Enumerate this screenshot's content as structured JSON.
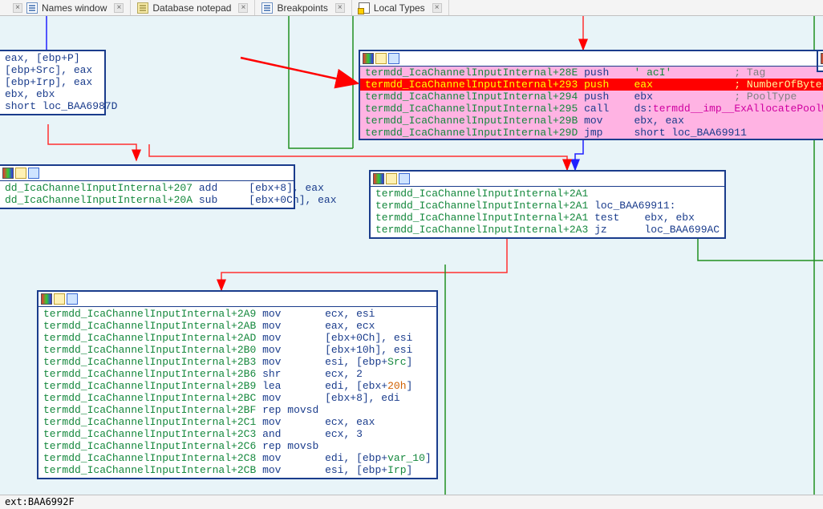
{
  "tabs": [
    {
      "label": "Names window",
      "icon": "doc"
    },
    {
      "label": "Database notepad",
      "icon": "db"
    },
    {
      "label": "Breakpoints",
      "icon": "doc"
    },
    {
      "label": "Local Types",
      "icon": "types"
    }
  ],
  "nodeA": {
    "lines": [
      "eax, [ebp+P]",
      "[ebp+Src], eax",
      "[ebp+Irp], eax",
      "ebx, ebx",
      "short loc_BAA6987D"
    ]
  },
  "nodeB": {
    "l1_loc": "dd_IcaChannelInputInternal+207",
    "l1_mn": "add",
    "l1_op": "[ebx+8], eax",
    "l2_loc": "dd_IcaChannelInputInternal+20A",
    "l2_mn": "sub",
    "l2_op": "[ebx+0Ch], eax"
  },
  "nodeC": {
    "l1_loc": "termdd_IcaChannelInputInternal+28E",
    "l1_mn": "push",
    "l1_op": "' acI'",
    "l1_cm": "; Tag",
    "l2_loc": "termdd_IcaChannelInputInternal+293",
    "l2_mn": "push",
    "l2_op": "eax",
    "l2_cm": "; NumberOfBytes",
    "l3_loc": "termdd_IcaChannelInputInternal+294",
    "l3_mn": "push",
    "l3_op": "ebx",
    "l3_cm": "; PoolType",
    "l4_loc": "termdd_IcaChannelInputInternal+295",
    "l4_mn": "call",
    "l4_pre": "ds:",
    "l4_fn": "termdd__imp__ExAllocatePoolWithTag",
    "l5_loc": "termdd_IcaChannelInputInternal+29B",
    "l5_mn": "mov",
    "l5_op": "ebx, eax",
    "l6_loc": "termdd_IcaChannelInputInternal+29D",
    "l6_mn": "jmp",
    "l6_op": "short loc_BAA69911"
  },
  "nodeD": {
    "l1_loc": "termdd_IcaChannelInputInternal+2A1",
    "l1_txt": "",
    "l2_loc": "termdd_IcaChannelInputInternal+2A1",
    "l2_lbl": "loc_BAA69911:",
    "l3_loc": "termdd_IcaChannelInputInternal+2A1",
    "l3_mn": "test",
    "l3_op": "ebx, ebx",
    "l4_loc": "termdd_IcaChannelInputInternal+2A3",
    "l4_mn": "jz",
    "l4_op": "loc_BAA699AC"
  },
  "nodeE": {
    "rows": [
      {
        "loc": "termdd_IcaChannelInputInternal+2A9",
        "mn": "mov",
        "op": "ecx, esi"
      },
      {
        "loc": "termdd_IcaChannelInputInternal+2AB",
        "mn": "mov",
        "op": "eax, ecx"
      },
      {
        "loc": "termdd_IcaChannelInputInternal+2AD",
        "mn": "mov",
        "op": "[ebx+0Ch], esi"
      },
      {
        "loc": "termdd_IcaChannelInputInternal+2B0",
        "mn": "mov",
        "op": "[ebx+10h], esi"
      },
      {
        "loc": "termdd_IcaChannelInputInternal+2B3",
        "mn": "mov",
        "op": "esi, [ebp+Src]",
        "src": true
      },
      {
        "loc": "termdd_IcaChannelInputInternal+2B6",
        "mn": "shr",
        "op": "ecx, 2"
      },
      {
        "loc": "termdd_IcaChannelInputInternal+2B9",
        "mn": "lea",
        "op": "edi, [ebx+",
        "num": "20h",
        "tail": "]"
      },
      {
        "loc": "termdd_IcaChannelInputInternal+2BC",
        "mn": "mov",
        "op": "[ebx+8], edi"
      },
      {
        "loc": "termdd_IcaChannelInputInternal+2BF",
        "mn": "rep movsd",
        "op": ""
      },
      {
        "loc": "termdd_IcaChannelInputInternal+2C1",
        "mn": "mov",
        "op": "ecx, eax"
      },
      {
        "loc": "termdd_IcaChannelInputInternal+2C3",
        "mn": "and",
        "op": "ecx, 3"
      },
      {
        "loc": "termdd_IcaChannelInputInternal+2C6",
        "mn": "rep movsb",
        "op": ""
      },
      {
        "loc": "termdd_IcaChannelInputInternal+2C8",
        "mn": "mov",
        "op": "edi, [ebp+var_10]",
        "var": true
      },
      {
        "loc": "termdd_IcaChannelInputInternal+2CB",
        "mn": "mov",
        "op": "esi, [ebp+Irp]",
        "irp": true
      }
    ]
  },
  "status": "ext:BAA6992F"
}
